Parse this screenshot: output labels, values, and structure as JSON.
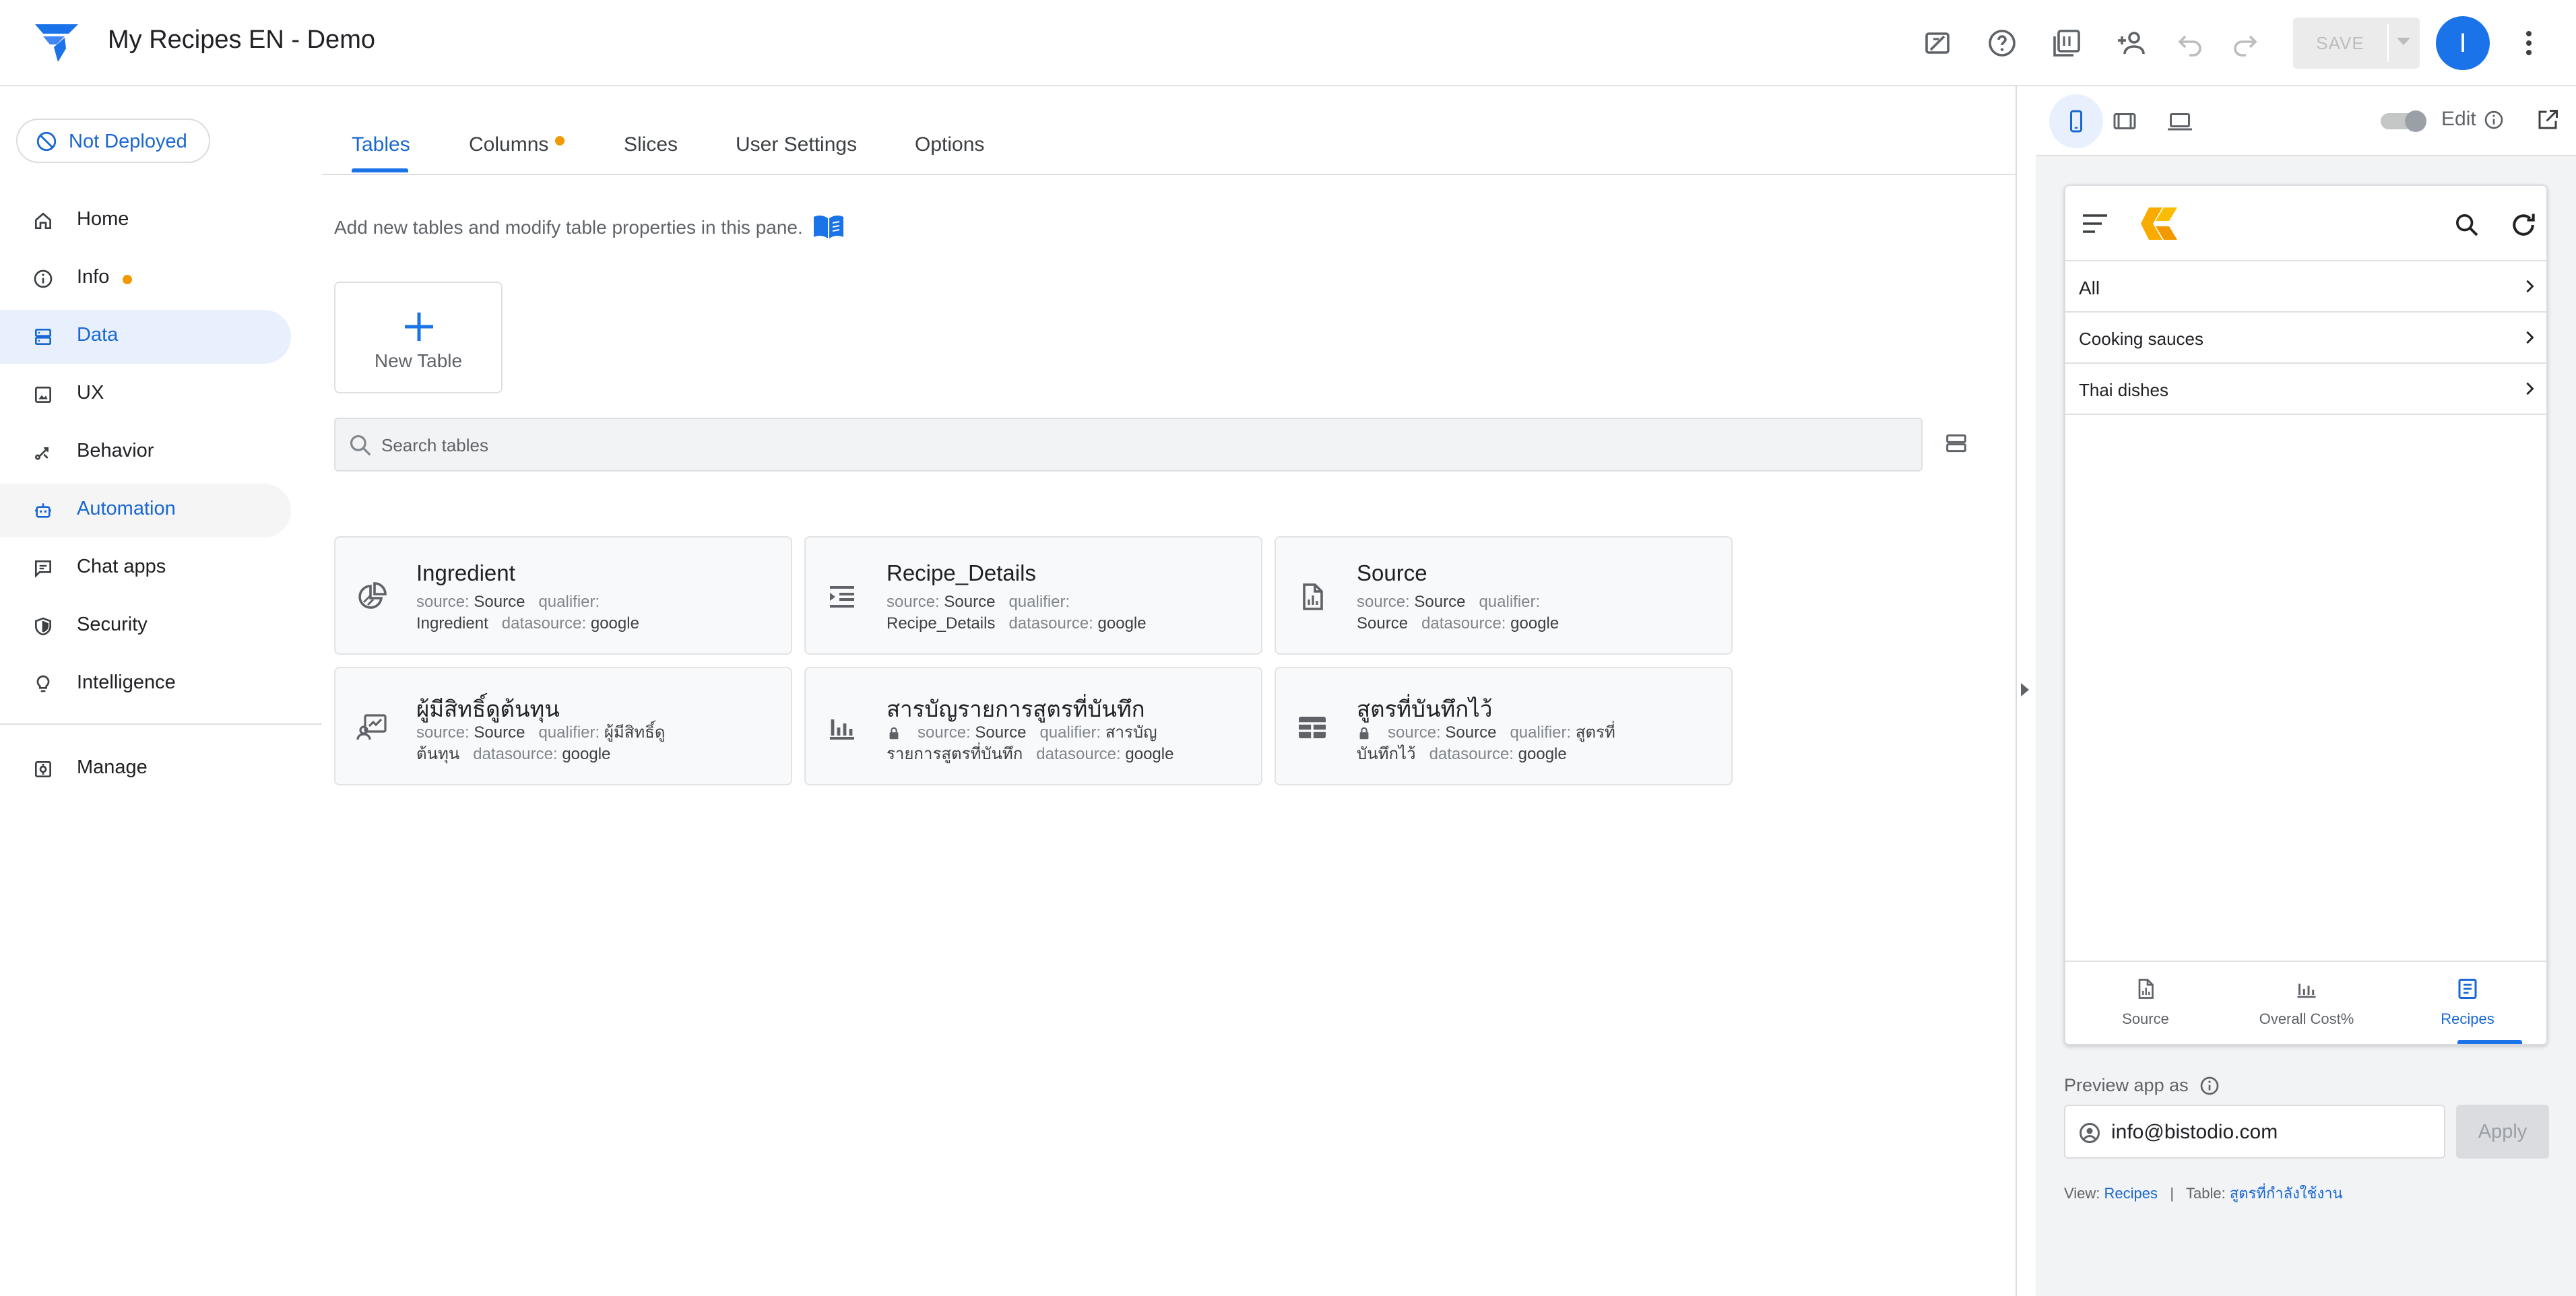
{
  "app": {
    "title": "My Recipes EN - Demo"
  },
  "topbar": {
    "save_label": "SAVE",
    "avatar_letter": "I"
  },
  "deploy": {
    "label": "Not Deployed"
  },
  "nav": {
    "items": [
      {
        "label": "Home",
        "icon": "home-icon"
      },
      {
        "label": "Info",
        "icon": "info-icon"
      },
      {
        "label": "Data",
        "icon": "data-icon"
      },
      {
        "label": "UX",
        "icon": "ux-icon"
      },
      {
        "label": "Behavior",
        "icon": "behavior-icon"
      },
      {
        "label": "Automation",
        "icon": "automation-icon"
      },
      {
        "label": "Chat apps",
        "icon": "chat-icon"
      },
      {
        "label": "Security",
        "icon": "shield-icon"
      },
      {
        "label": "Intelligence",
        "icon": "lightbulb-icon"
      },
      {
        "label": "Manage",
        "icon": "manage-icon"
      }
    ]
  },
  "tabs": [
    "Tables",
    "Columns",
    "Slices",
    "User Settings",
    "Options"
  ],
  "main": {
    "description": "Add new tables and modify table properties in this pane.",
    "new_table_label": "New Table",
    "search_placeholder": "Search tables"
  },
  "meta_labels": {
    "source": "source:",
    "qualifier": "qualifier:",
    "datasource": "datasource:"
  },
  "tables": [
    {
      "name": "Ingredient",
      "source": "Source",
      "qualifier": "Ingredient",
      "datasource": "google",
      "icon": "pie-chart-icon",
      "locked": false
    },
    {
      "name": "Recipe_Details",
      "source": "Source",
      "qualifier": "Recipe_Details",
      "datasource": "google",
      "icon": "list-indent-icon",
      "locked": false
    },
    {
      "name": "Source",
      "source": "Source",
      "qualifier": "Source",
      "datasource": "google",
      "icon": "document-chart-icon",
      "locked": false
    },
    {
      "name": "ผู้มีสิทธิ์ดูต้นทุน",
      "source": "Source",
      "qualifier": "ผู้มีสิทธิ์ดูต้นทุน",
      "datasource": "google",
      "icon": "person-chart-icon",
      "locked": false
    },
    {
      "name": "สารบัญรายการสูตรที่บันทึก",
      "source": "Source",
      "qualifier": "สารบัญรายการสูตรที่บันทึก",
      "datasource": "google",
      "icon": "bar-chart-icon",
      "locked": true
    },
    {
      "name": "สูตรที่บันทึกไว้",
      "source": "Source",
      "qualifier": "สูตรที่บันทึกไว้",
      "datasource": "google",
      "icon": "table-icon",
      "locked": true
    }
  ],
  "preview": {
    "edit_label": "Edit",
    "rows": [
      "All",
      "Cooking sauces",
      "Thai dishes"
    ],
    "bottom_nav": [
      "Source",
      "Overall Cost%",
      "Recipes"
    ],
    "preview_as_label": "Preview app as",
    "email": "info@bistodio.com",
    "apply_label": "Apply",
    "view_label": "View:",
    "view_value": "Recipes",
    "separator": "|",
    "table_label": "Table:",
    "table_value": "สูตรที่กำลังใช้งาน"
  },
  "colors": {
    "accent": "#1a73e8",
    "active_bg": "#e8f0fe",
    "badge_orange": "#f29900",
    "logo_yellow": "#f9ab00"
  }
}
